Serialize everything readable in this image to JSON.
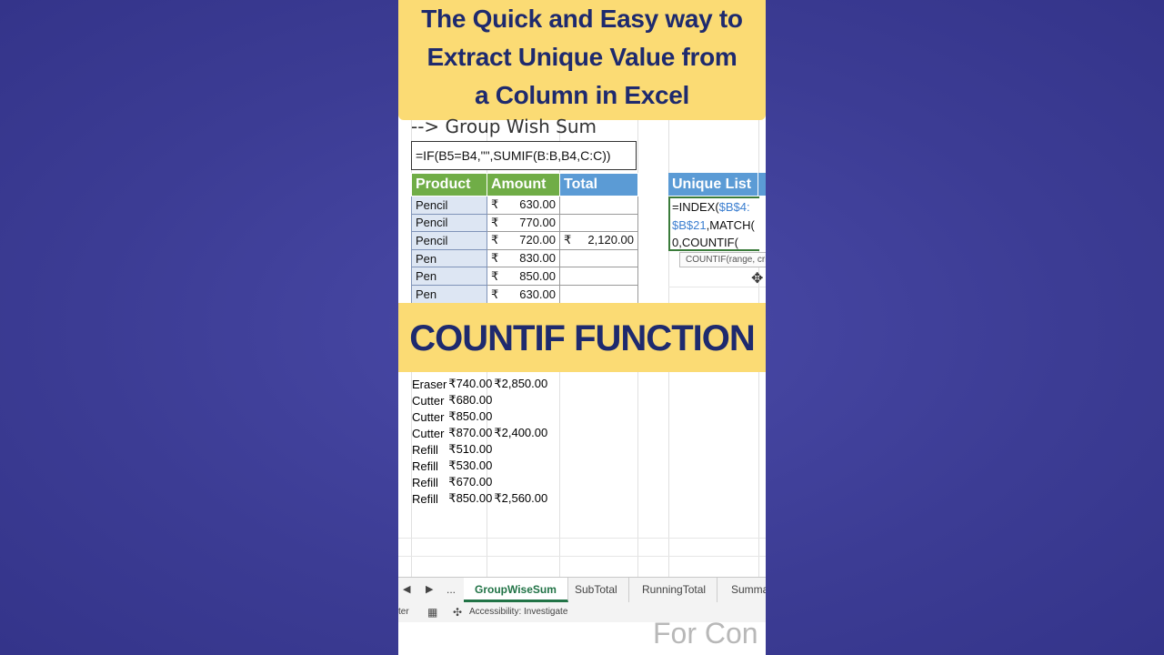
{
  "title": {
    "line1": "The Quick and Easy way to",
    "line2": "Extract Unique Value from",
    "line3": "a Column in Excel"
  },
  "section_heading": "--> Group Wish Sum",
  "formula_bar": "=IF(B5=B4,\"\",SUMIF(B:B,B4,C:C))",
  "table": {
    "headers": [
      "Product",
      "Amount",
      "Total"
    ],
    "currency": "₹",
    "rows": [
      {
        "product": "Pencil",
        "amount": "630.00",
        "total": ""
      },
      {
        "product": "Pencil",
        "amount": "770.00",
        "total": ""
      },
      {
        "product": "Pencil",
        "amount": "720.00",
        "total": "2,120.00"
      },
      {
        "product": "Pen",
        "amount": "830.00",
        "total": ""
      },
      {
        "product": "Pen",
        "amount": "850.00",
        "total": ""
      },
      {
        "product": "Pen",
        "amount": "630.00",
        "total": ""
      }
    ],
    "rows_lower": [
      {
        "product": "Eraser",
        "amount": "740.00",
        "total": "2,850.00"
      },
      {
        "product": "Cutter",
        "amount": "680.00",
        "total": ""
      },
      {
        "product": "Cutter",
        "amount": "850.00",
        "total": ""
      },
      {
        "product": "Cutter",
        "amount": "870.00",
        "total": "2,400.00"
      },
      {
        "product": "Refill",
        "amount": "510.00",
        "total": ""
      },
      {
        "product": "Refill",
        "amount": "530.00",
        "total": ""
      },
      {
        "product": "Refill",
        "amount": "670.00",
        "total": ""
      },
      {
        "product": "Refill",
        "amount": "850.00",
        "total": "2,560.00"
      }
    ]
  },
  "unique_list": {
    "header": "Unique List",
    "formula_line1_a": "=INDEX(",
    "formula_line1_b": "$B$4:",
    "formula_line2_a": "$B$21",
    "formula_line2_b": ",MATCH(",
    "formula_line3": "0,COUNTIF(",
    "tooltip": "COUNTIF(range, criteria)"
  },
  "banner_countif": "COUNTIF FUNCTION",
  "sheet_tabs": {
    "more": "...",
    "tabs": [
      "GroupWiseSum",
      "SubTotal",
      "RunningTotal",
      "Summa"
    ]
  },
  "statusbar": {
    "left": "ter",
    "accessibility": "Accessibility: Investigate"
  },
  "watermark": "For Con",
  "colors": {
    "banner": "#fbdb74",
    "banner_text": "#1e2a6e",
    "header_green": "#70ad47",
    "header_blue": "#5b9bd5",
    "background": "#3c3c94"
  }
}
